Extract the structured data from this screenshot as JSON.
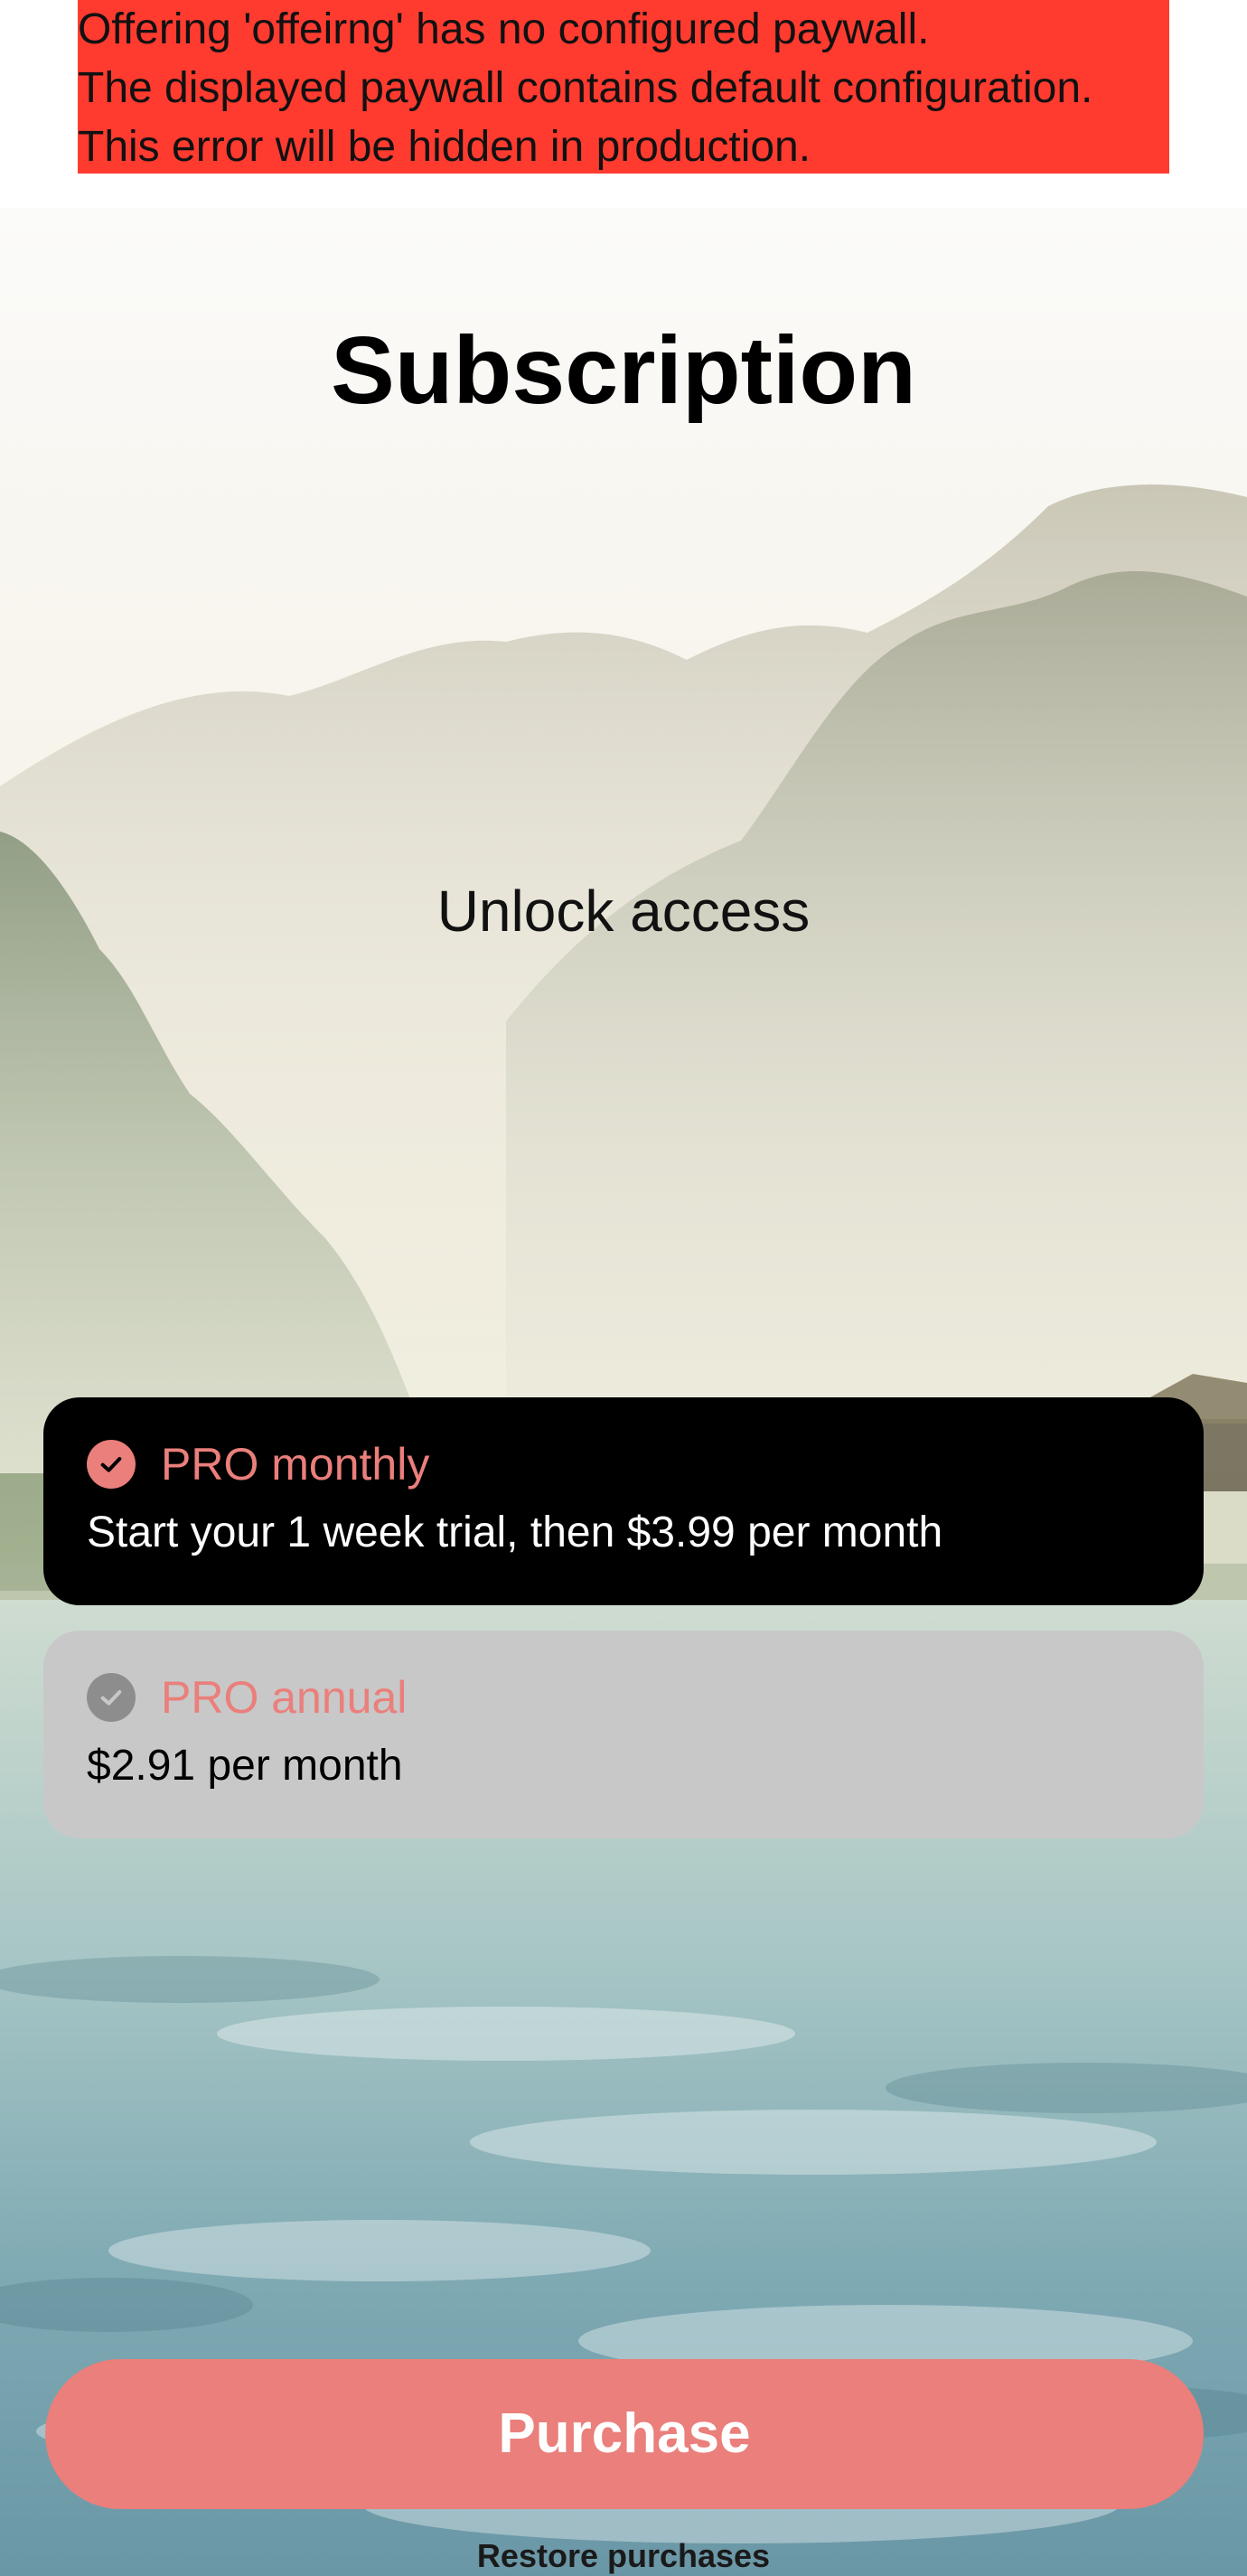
{
  "error_banner": {
    "lines": [
      "Offering 'offeirng' has no configured paywall.",
      "The displayed paywall contains default configuration.",
      "This error will be hidden in production."
    ],
    "color": "#ff3b30"
  },
  "header": {
    "title": "Subscription"
  },
  "main": {
    "subtitle": "Unlock access"
  },
  "products": [
    {
      "name": "PRO monthly",
      "description": "Start your 1 week trial, then $3.99 per month",
      "selected": true,
      "icon": "checkmark-circle-icon"
    },
    {
      "name": "PRO annual",
      "description": "$2.91 per month",
      "selected": false,
      "icon": "checkmark-circle-icon"
    }
  ],
  "footer": {
    "purchase_label": "Purchase",
    "restore_label": "Restore purchases"
  },
  "colors": {
    "accent": "#ea7f7b",
    "selected_card": "#000000",
    "unselected_card": "#c8c8c8"
  },
  "background": {
    "icon": "misty-lake-landscape-image"
  }
}
